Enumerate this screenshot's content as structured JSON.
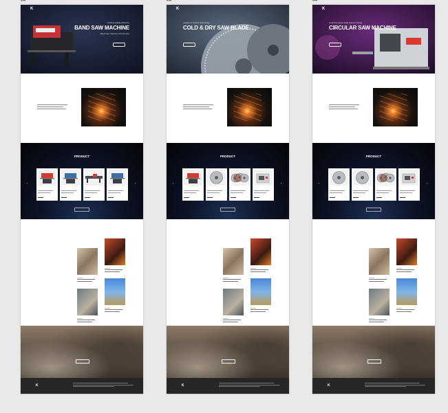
{
  "boards": [
    {
      "id": "board-1",
      "logo": "K",
      "logo_sub": "",
      "nav": [
        "",
        "",
        "",
        ""
      ],
      "hero": {
        "subtitle": "Cutting Quality Machine",
        "title": "BAND SAW MACHINE",
        "desc": "Band Saw Machine Productivity",
        "button": "",
        "align": "right",
        "colors": [
          "#2a3450",
          "#0d1120"
        ]
      },
      "service": {
        "tag": "",
        "heading": "",
        "more": ""
      },
      "product": {
        "title": "PRODUCT",
        "subtitle": "",
        "viewall": "",
        "items": [
          {
            "name": "",
            "type": "bandsaw"
          },
          {
            "name": "",
            "type": "bandsaw-blue"
          },
          {
            "name": "",
            "type": "long-machine"
          },
          {
            "name": "",
            "type": "bandsaw-blue"
          }
        ]
      },
      "news": {
        "tag": "",
        "heading": "",
        "more": ""
      },
      "banner": {
        "text1": "",
        "text2": "",
        "button": ""
      },
      "footer": {
        "logo": "K",
        "logo_sub": ""
      }
    },
    {
      "id": "board-2",
      "logo": "K",
      "logo_sub": "",
      "nav": [
        "",
        "",
        "",
        ""
      ],
      "hero": {
        "subtitle": "Leader of Cutting Technology",
        "title": "COLD & DRY SAW BLADE",
        "desc": "",
        "button": "",
        "align": "left",
        "colors": [
          "#5c6c80",
          "#1e2530"
        ]
      },
      "service": {
        "tag": "",
        "heading": "",
        "more": ""
      },
      "product": {
        "title": "PRODUCT",
        "subtitle": "",
        "viewall": "",
        "items": [
          {
            "name": "",
            "type": "bandsaw"
          },
          {
            "name": "",
            "type": "blade"
          },
          {
            "name": "",
            "type": "blade-multi"
          },
          {
            "name": "",
            "type": "circular-machine"
          }
        ]
      },
      "news": {
        "tag": "",
        "heading": "",
        "more": ""
      },
      "banner": {
        "text1": "",
        "text2": "",
        "button": ""
      },
      "footer": {
        "logo": "K",
        "logo_sub": ""
      }
    },
    {
      "id": "board-3",
      "logo": "K",
      "logo_sub": "",
      "nav": [
        "",
        "",
        "",
        ""
      ],
      "hero": {
        "subtitle": "Amazing Heavy-High Speed Cutting",
        "title": "CIRCULAR SAW MACHINE",
        "desc": "",
        "button": "",
        "align": "left",
        "colors": [
          "#6a2a7a",
          "#1a0c24"
        ]
      },
      "service": {
        "tag": "",
        "heading": "",
        "more": ""
      },
      "product": {
        "title": "PRODUCT",
        "subtitle": "",
        "viewall": "",
        "items": [
          {
            "name": "",
            "type": "blade"
          },
          {
            "name": "",
            "type": "blade"
          },
          {
            "name": "",
            "type": "blade-multi"
          },
          {
            "name": "",
            "type": "circular-machine"
          }
        ]
      },
      "news": {
        "tag": "",
        "heading": "",
        "more": ""
      },
      "banner": {
        "text1": "",
        "text2": "",
        "button": ""
      },
      "footer": {
        "logo": "K",
        "logo_sub": ""
      }
    }
  ],
  "colors": {
    "canvas": "#e9e9ea",
    "footer": "#262626",
    "product_bg": "#0d1428",
    "white": "#ffffff"
  }
}
